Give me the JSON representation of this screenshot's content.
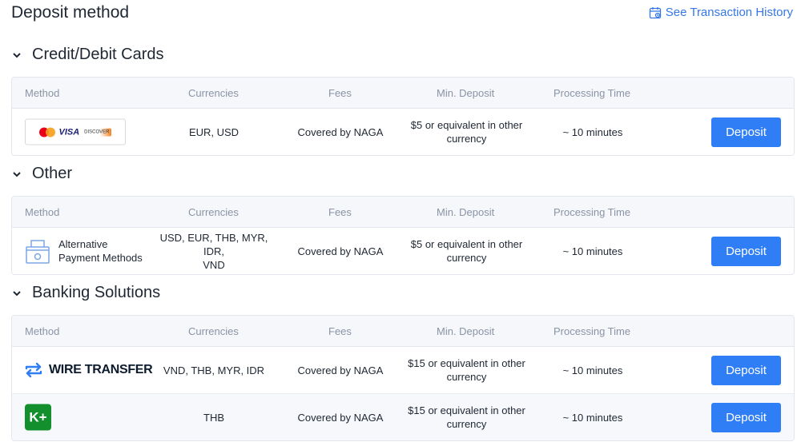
{
  "header": {
    "title": "Deposit method",
    "history_link": "See Transaction History"
  },
  "columns": {
    "method": "Method",
    "currencies": "Currencies",
    "fees": "Fees",
    "min_deposit": "Min. Deposit",
    "processing_time": "Processing Time"
  },
  "sections": [
    {
      "title": "Credit/Debit Cards",
      "rows": [
        {
          "method_logo": [
            "mastercard",
            "VISA",
            "DISCOVER"
          ],
          "currencies": "EUR, USD",
          "fees": "Covered by NAGA",
          "min_deposit_line1": "$5 or equivalent in other",
          "min_deposit_line2": "currency",
          "processing_time": "~ 10 minutes",
          "button": "Deposit"
        }
      ]
    },
    {
      "title": "Other",
      "rows": [
        {
          "method_line1": "Alternative",
          "method_line2": "Payment Methods",
          "currencies_line1": "USD, EUR, THB, MYR, IDR,",
          "currencies_line2": "VND",
          "fees": "Covered by NAGA",
          "min_deposit_line1": "$5 or equivalent in other",
          "min_deposit_line2": "currency",
          "processing_time": "~ 10 minutes",
          "button": "Deposit"
        }
      ]
    },
    {
      "title": "Banking Solutions",
      "rows": [
        {
          "method_name": "WIRE TRANSFER",
          "currencies": "VND, THB, MYR, IDR",
          "fees": "Covered by NAGA",
          "min_deposit_line1": "$15 or equivalent in other",
          "min_deposit_line2": "currency",
          "processing_time": "~ 10 minutes",
          "button": "Deposit"
        },
        {
          "method_logo_text": "K+",
          "currencies": "THB",
          "fees": "Covered by NAGA",
          "min_deposit_line1": "$15 or equivalent in other",
          "min_deposit_line2": "currency",
          "processing_time": "~ 10 minutes",
          "button": "Deposit"
        }
      ]
    }
  ],
  "colors": {
    "accent": "#2f7ef5",
    "link": "#3578e5",
    "header_bg": "#f5f7fa",
    "alt_row_bg": "#f6f8fb",
    "kplus_green": "#138f2d"
  }
}
